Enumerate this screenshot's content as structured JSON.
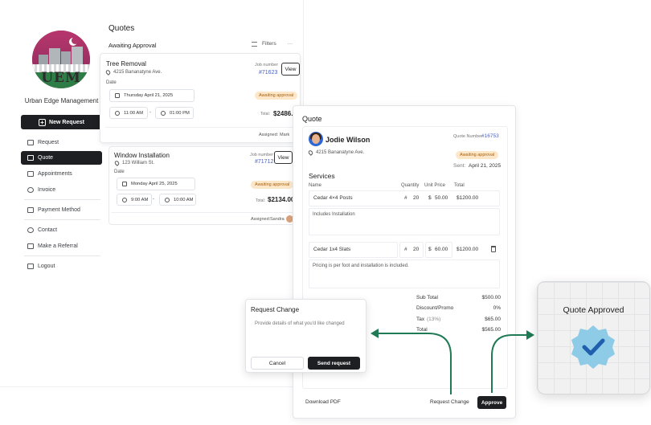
{
  "sidebar": {
    "logo_text": "UEM",
    "company_name": "Urban Edge Management",
    "new_request_label": "New Request",
    "items": [
      {
        "label": "Request"
      },
      {
        "label": "Quote"
      },
      {
        "label": "Appointments"
      },
      {
        "label": "Invoice"
      },
      {
        "label": "Payment Method"
      },
      {
        "label": "Contact"
      },
      {
        "label": "Make a Referral"
      },
      {
        "label": "Logout"
      }
    ],
    "active_item": "Quote"
  },
  "quotes": {
    "title": "Quotes",
    "section": "Awaiting Approval",
    "filters_label": "Filters",
    "more_label": "···",
    "cards": [
      {
        "title": "Tree Removal",
        "address": "4215 Bananatyne Ave.",
        "job_number_label": "Job number",
        "job_number": "#71623",
        "view_label": "View",
        "date_label": "Date",
        "date": "Thursday April 21, 2025",
        "status": "Awaiting approval",
        "start_time": "11:00 AM",
        "dash": "-",
        "end_time": "01:00 PM",
        "total_label": "Total:",
        "total": "$2486.00",
        "assigned_label": "Assigned:",
        "assigned": "Mark"
      },
      {
        "title": "Window Installation",
        "address": "123 William St.",
        "job_number_label": "Job number",
        "job_number": "#71712",
        "view_label": "View",
        "date_label": "Date",
        "date": "Monday April 25, 2025",
        "status": "Awaiting approval",
        "start_time": "9:00 AM",
        "dash": "-",
        "end_time": "10:00 AM",
        "total_label": "Total:",
        "total": "$2134.00",
        "assigned_label": "Assigned:",
        "assigned": "Sandra"
      }
    ]
  },
  "quote": {
    "panel_title": "Quote",
    "client_name": "Jodie Wilson",
    "quote_number_label": "Quote Number:",
    "quote_number": "#16753",
    "address": "4215 Bananatyne Ave.",
    "status": "Awaiting approval",
    "sent_label": "Sent:",
    "sent_date": "April 21, 2025",
    "services_heading": "Services",
    "columns": [
      "Name",
      "Quantity",
      "Unit Price",
      "Total"
    ],
    "lines": [
      {
        "name": "Cedar 4×4 Posts",
        "qty_prefix": "#",
        "qty": "20",
        "price_prefix": "$",
        "unit_price": "50.00",
        "total": "$1200.00",
        "note": "Includes Installation"
      },
      {
        "name": "Cedar 1x4 Slats",
        "qty_prefix": "#",
        "qty": "20",
        "price_prefix": "$",
        "unit_price": "60.00",
        "total": "$1200.00",
        "note": "Pricing is per foot and installation is included."
      }
    ],
    "summary": {
      "subtotal_label": "Sub Total",
      "subtotal": "$500.00",
      "discount_label": "Discount/Promo",
      "discount": "0%",
      "tax_label": "Tax",
      "tax_rate": "(13%)",
      "tax": "$65.00",
      "total_label": "Total",
      "total": "$565.00"
    },
    "download_label": "Download PDF",
    "request_change_label": "Request Change",
    "approve_label": "Approve"
  },
  "request_change": {
    "title": "Request Change",
    "placeholder": "Provide details of what you'd like changed",
    "cancel_label": "Cancel",
    "send_label": "Send request"
  },
  "approved": {
    "title": "Quote Approved",
    "badge_color": "#8ecbe6",
    "check_color": "#1f5fae"
  },
  "colors": {
    "accent_dark": "#1e1f22",
    "link_blue": "#4a5fc1",
    "badge_bg": "#fde7c8",
    "badge_text": "#a76212",
    "arrow_green": "#1f7a55"
  }
}
